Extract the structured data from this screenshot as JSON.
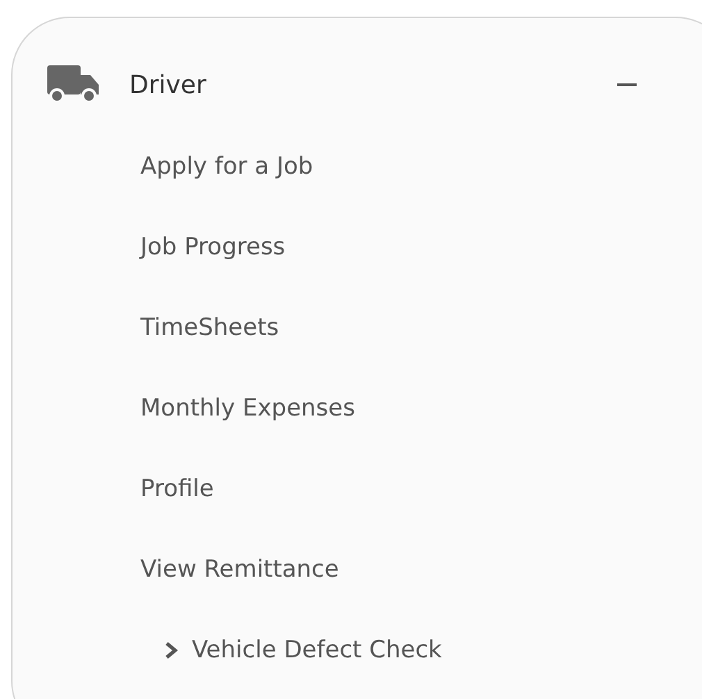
{
  "section": {
    "title": "Driver",
    "expanded": true
  },
  "items": [
    {
      "label": "Apply for a Job",
      "kind": "link"
    },
    {
      "label": "Job Progress",
      "kind": "link"
    },
    {
      "label": "TimeSheets",
      "kind": "link"
    },
    {
      "label": "Monthly Expenses",
      "kind": "link"
    },
    {
      "label": "Profile",
      "kind": "link"
    },
    {
      "label": "View Remittance",
      "kind": "link"
    },
    {
      "label": "Vehicle Defect Check",
      "kind": "submenu"
    }
  ]
}
